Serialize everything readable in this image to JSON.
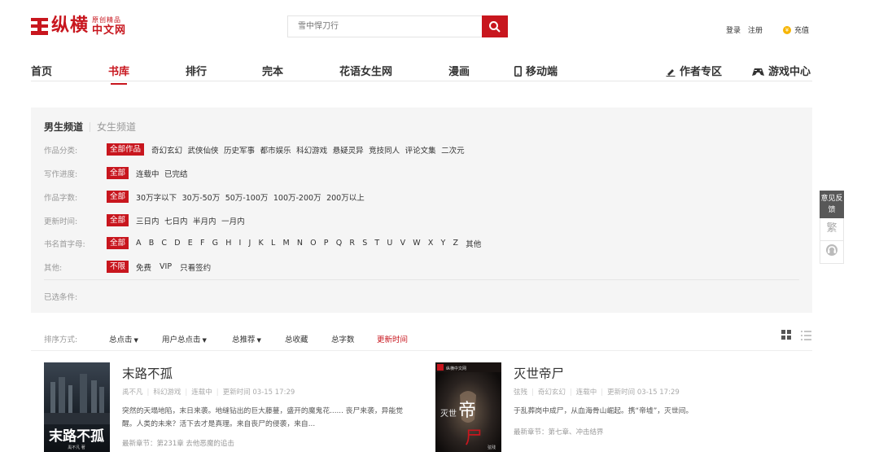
{
  "brand": {
    "logo_main": "纵横",
    "logo_small_top": "原创精品",
    "logo_small_bottom": "中文网"
  },
  "search": {
    "placeholder": "雪中悍刀行"
  },
  "user": {
    "login": "登录",
    "register": "注册",
    "recharge": "充值"
  },
  "nav": {
    "items": [
      "首页",
      "书库",
      "排行",
      "完本",
      "花语女生网",
      "漫画",
      "移动端",
      "作者专区",
      "游戏中心"
    ],
    "active": "书库"
  },
  "filter": {
    "tabs": {
      "male": "男生频道",
      "female": "女生频道"
    },
    "rows": [
      {
        "label": "作品分类:",
        "selected": "全部作品",
        "options": [
          "奇幻玄幻",
          "武侠仙侠",
          "历史军事",
          "都市娱乐",
          "科幻游戏",
          "悬疑灵异",
          "竞技同人",
          "评论文集",
          "二次元"
        ]
      },
      {
        "label": "写作进度:",
        "selected": "全部",
        "options": [
          "连载中",
          "已完结"
        ]
      },
      {
        "label": "作品字数:",
        "selected": "全部",
        "options": [
          "30万字以下",
          "30万-50万",
          "50万-100万",
          "100万-200万",
          "200万以上"
        ]
      },
      {
        "label": "更新时间:",
        "selected": "全部",
        "options": [
          "三日内",
          "七日内",
          "半月内",
          "一月内"
        ]
      },
      {
        "label": "书名首字母:",
        "selected": "全部",
        "options": [
          "A",
          "B",
          "C",
          "D",
          "E",
          "F",
          "G",
          "H",
          "I",
          "J",
          "K",
          "L",
          "M",
          "N",
          "O",
          "P",
          "Q",
          "R",
          "S",
          "T",
          "U",
          "V",
          "W",
          "X",
          "Y",
          "Z",
          "其他"
        ]
      },
      {
        "label": "其他:",
        "selected": "不限",
        "options": [
          "免费",
          "VIP",
          "只看签约"
        ]
      }
    ],
    "selected_label": "已选条件:"
  },
  "sort": {
    "label": "排序方式:",
    "options": [
      "总点击",
      "用户总点击",
      "总推荐",
      "总收藏",
      "总字数",
      "更新时间"
    ]
  },
  "books": [
    {
      "title": "末路不孤",
      "author": "禹不凡",
      "genre": "科幻游戏",
      "status": "连载中",
      "updated": "更新时间 03-15 17:29",
      "desc": "突然的天塌地陷，末日来袭。地缝钻出的巨大藤蔓，盛开的魔鬼花...... 丧尸来袭，异能觉醒。人类的未来？活下去才是真理。来自丧尸的侵袭，来自...",
      "latest": "最新章节：第231章 去他恶魔的追击",
      "cover_text": "末路不孤",
      "cover_author": "禹不凡 著"
    },
    {
      "title": "灭世帝尸",
      "author": "弦残",
      "genre": "奇幻玄幻",
      "status": "连载中",
      "updated": "更新时间 03-15 17:29",
      "desc": "于乱葬岗中成尸，从血海骨山崛起。携“帝墟”，灭世间。",
      "latest": "最新章节：第七章、冲击结界",
      "cover_text_a": "灭世",
      "cover_text_b": "帝",
      "cover_text_c": "尸",
      "cover_badge": "纵横中文网",
      "cover_side": "弦残"
    }
  ],
  "side": {
    "feedback": "意见反馈",
    "trad": "繁"
  },
  "colors": {
    "accent": "#c8161e",
    "filter_bg": "#f5f5f5"
  }
}
